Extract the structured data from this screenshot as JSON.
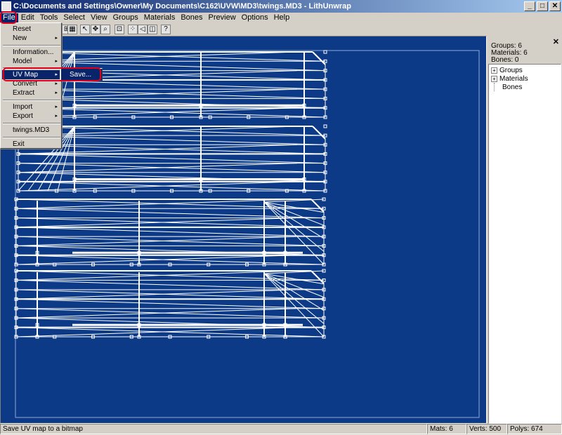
{
  "window": {
    "title": "C:\\Documents and Settings\\Owner\\My Documents\\C162\\UVW\\MD3\\twings.MD3 - LithUnwrap",
    "minimize_label": "_",
    "maximize_label": "□",
    "close_label": "✕"
  },
  "menubar": [
    "File",
    "Edit",
    "Tools",
    "Select",
    "View",
    "Groups",
    "Materials",
    "Bones",
    "Preview",
    "Options",
    "Help"
  ],
  "file_menu": {
    "items": [
      "Reset",
      "New",
      "Information...",
      "Model",
      "UV Map",
      "Convert",
      "Extract",
      "Import",
      "Export",
      "twings.MD3",
      "Exit"
    ],
    "submenu_arrow": "▸",
    "uv_map_submenu": [
      "Save..."
    ]
  },
  "toolbar": {
    "icons": [
      "grid-icon",
      "grid2-icon",
      "pointer-icon",
      "move-icon",
      "zoom-icon",
      "fit-icon",
      "vertex-icon",
      "edge-icon",
      "face-icon",
      "help-pointer-icon"
    ]
  },
  "side_panel": {
    "close_label": "✕",
    "stats": [
      "Groups: 6",
      "Materials: 6",
      "Bones: 0"
    ],
    "tree": [
      {
        "label": "Groups",
        "expander": "+"
      },
      {
        "label": "Materials",
        "expander": "+"
      },
      {
        "label": "Bones",
        "expander": ""
      }
    ]
  },
  "statusbar": {
    "message": "Save UV map to a bitmap",
    "mats": "Mats: 6",
    "verts": "Verts: 500",
    "polys": "Polys: 674"
  },
  "colors": {
    "canvas_bg": "#0c3a86",
    "wire": "#ffffff",
    "selection": "#0a246a",
    "highlight_ring": "#e0001b"
  }
}
